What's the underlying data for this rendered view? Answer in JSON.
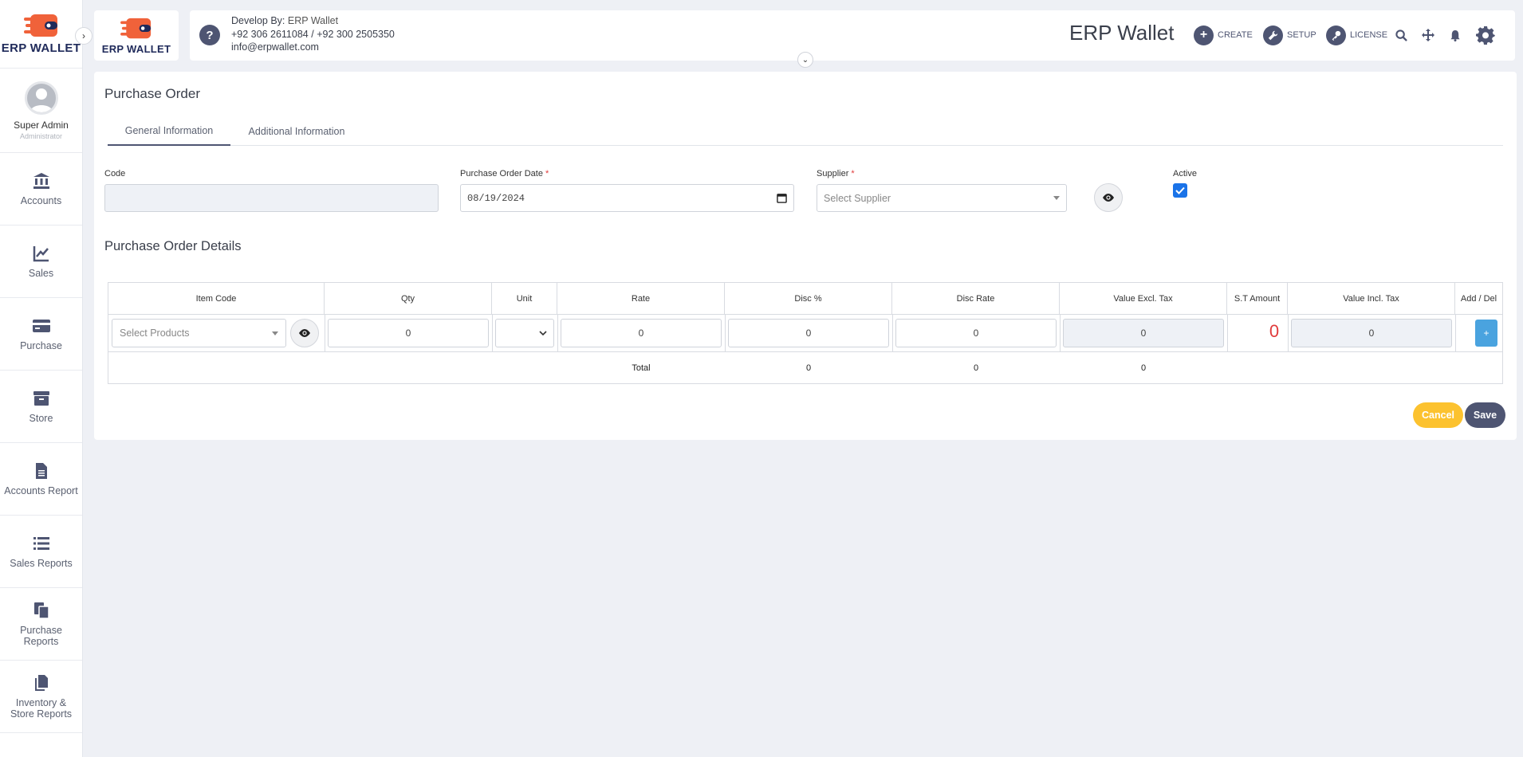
{
  "sidebar": {
    "logo_text": "ERP WALLET",
    "profile": {
      "name": "Super Admin",
      "role": "Administrator"
    },
    "items": [
      {
        "label": "Accounts",
        "icon": "bank-icon"
      },
      {
        "label": "Sales",
        "icon": "chart-line-icon"
      },
      {
        "label": "Purchase",
        "icon": "credit-card-icon"
      },
      {
        "label": "Store",
        "icon": "archive-icon"
      },
      {
        "label": "Accounts Report",
        "icon": "file-text-icon"
      },
      {
        "label": "Sales Reports",
        "icon": "list-icon"
      },
      {
        "label": "Purchase Reports",
        "icon": "copy-files-icon"
      },
      {
        "label": "Inventory & Store Reports",
        "icon": "copy-file-icon"
      }
    ]
  },
  "header": {
    "brand_logo_text": "ERP WALLET",
    "developer": {
      "label": "Develop By:",
      "name": "ERP Wallet",
      "phone1": "+92 306 2611084",
      "separator": "/",
      "phone2": "+92 300 2505350",
      "email": "info@erpwallet.com"
    },
    "title": "ERP Wallet",
    "create_label": "CREATE",
    "setup_label": "SETUP",
    "license_label": "LICENSE"
  },
  "page": {
    "title": "Purchase Order",
    "tabs": [
      {
        "label": "General Information",
        "active": true
      },
      {
        "label": "Additional Information",
        "active": false
      }
    ],
    "fields": {
      "code_label": "Code",
      "code_value": "",
      "date_label": "Purchase Order Date",
      "date_value": "08/19/2024",
      "supplier_label": "Supplier",
      "supplier_placeholder": "Select Supplier",
      "required_mark": "*",
      "active_label": "Active",
      "active_checked": true
    },
    "details_title": "Purchase Order Details",
    "table": {
      "headers": [
        "Item Code",
        "Qty",
        "Unit",
        "Rate",
        "Disc %",
        "Disc Rate",
        "Value Excl. Tax",
        "S.T Amount",
        "Value Incl. Tax",
        "Add / Del"
      ],
      "row": {
        "product_placeholder": "Select Products",
        "qty": "0",
        "rate": "0",
        "disc_pct": "0",
        "disc_rate": "0",
        "value_excl": "0",
        "st_amount": "0",
        "value_incl": "0",
        "add_label": "+"
      },
      "total": {
        "label": "Total",
        "disc_pct": "0",
        "disc_rate": "0",
        "value_excl": "0"
      }
    },
    "buttons": {
      "cancel": "Cancel",
      "save": "Save"
    }
  },
  "colors": {
    "primary": "#4e5572",
    "accent_orange": "#f0623a",
    "cancel": "#fcc22f",
    "add": "#4aa3df",
    "danger": "#e03b3b",
    "checkbox": "#1a73e8"
  }
}
